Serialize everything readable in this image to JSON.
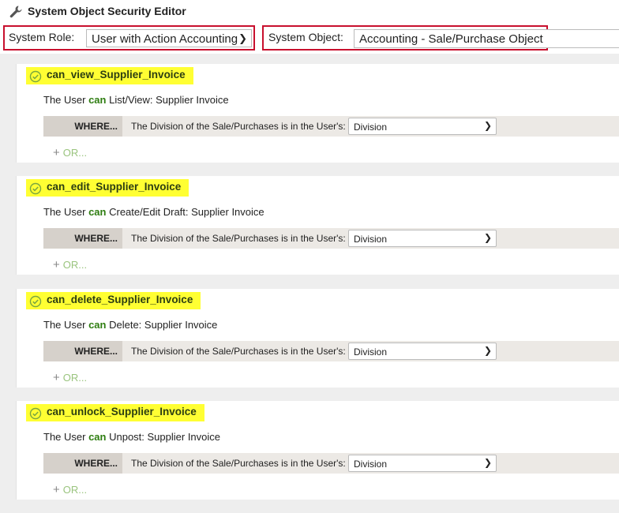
{
  "header": {
    "title": "System Object Security Editor",
    "icon": "wrench-icon"
  },
  "role": {
    "label": "System Role:",
    "value": "User with Action Accounting"
  },
  "object": {
    "label": "System Object:",
    "value": "Accounting - Sale/Purchase Object"
  },
  "colors": {
    "highlight": "#ffff33",
    "accent_green": "#2e7d10",
    "or_green": "#9ac47e",
    "red_frame": "#c8102e"
  },
  "permissions": [
    {
      "name": "can_view_Supplier_Invoice",
      "prefix": "The User ",
      "can": "can",
      "action": " List/View: Supplier Invoice",
      "where_label": "WHERE...",
      "where_text": "The Division of the Sale/Purchases is in the User's:",
      "where_value": "Division",
      "or_label": "OR..."
    },
    {
      "name": "can_edit_Supplier_Invoice",
      "prefix": "The User ",
      "can": "can",
      "action": " Create/Edit Draft: Supplier Invoice",
      "where_label": "WHERE...",
      "where_text": "The Division of the Sale/Purchases is in the User's:",
      "where_value": "Division",
      "or_label": "OR..."
    },
    {
      "name": "can_delete_Supplier_Invoice",
      "prefix": "The User ",
      "can": "can",
      "action": " Delete: Supplier Invoice",
      "where_label": "WHERE...",
      "where_text": "The Division of the Sale/Purchases is in the User's:",
      "where_value": "Division",
      "or_label": "OR..."
    },
    {
      "name": "can_unlock_Supplier_Invoice",
      "prefix": "The User ",
      "can": "can",
      "action": " Unpost: Supplier Invoice",
      "where_label": "WHERE...",
      "where_text": "The Division of the Sale/Purchases is in the User's:",
      "where_value": "Division",
      "or_label": "OR..."
    }
  ]
}
